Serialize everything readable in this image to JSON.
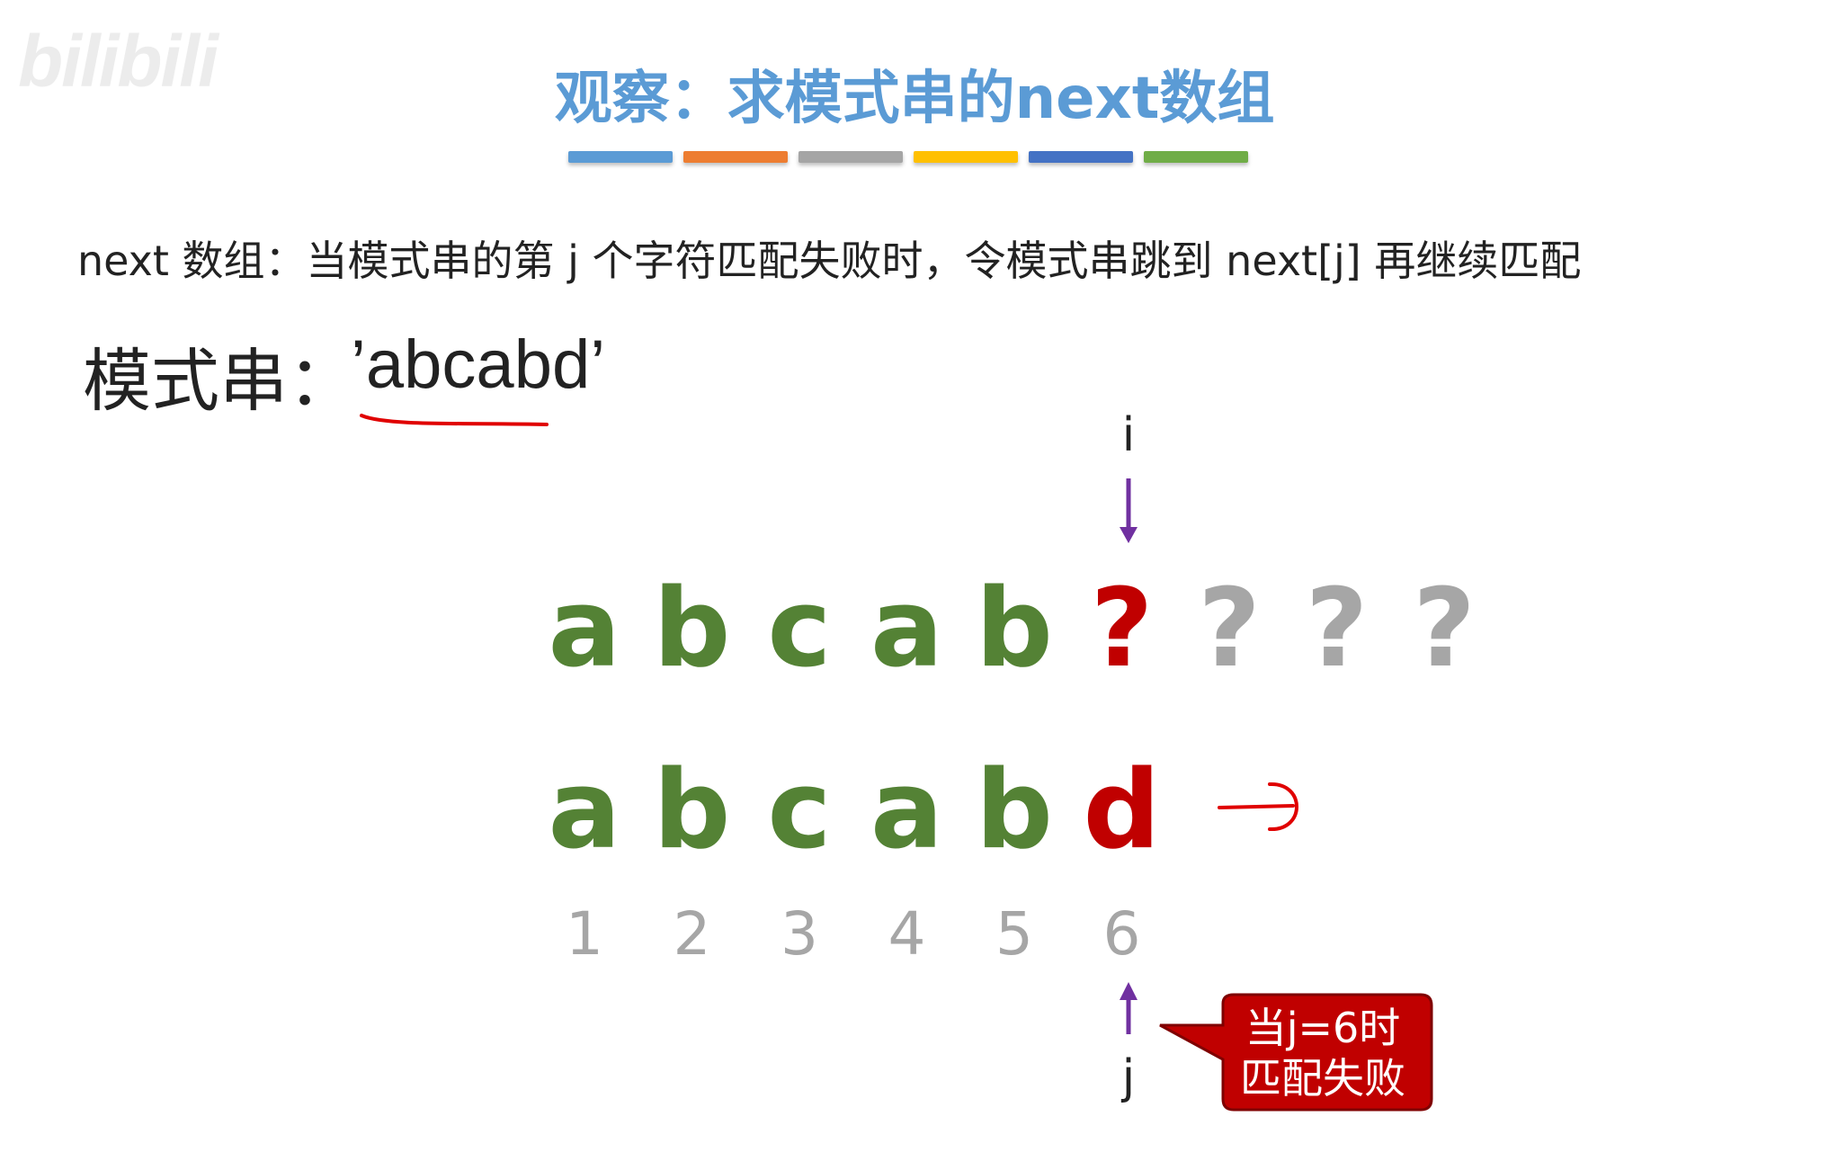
{
  "watermark": "bilibili",
  "title": "观察：求模式串的next数组",
  "title_bar_colors": [
    "#5b9bd5",
    "#ed7d31",
    "#a5a5a5",
    "#ffc000",
    "#4472c4",
    "#70ad47"
  ],
  "definition": "next 数组：当模式串的第 j 个字符匹配失败时，令模式串跳到 next[j] 再继续匹配",
  "pattern_label": "模式串：",
  "pattern_value": "’abcabd’",
  "main_string": [
    "a",
    "b",
    "c",
    "a",
    "b",
    "?",
    "?",
    "?",
    "?"
  ],
  "pattern_chars": [
    "a",
    "b",
    "c",
    "a",
    "b",
    "d"
  ],
  "indices": [
    "1",
    "2",
    "3",
    "4",
    "5",
    "6"
  ],
  "pointer_i_label": "i",
  "pointer_j_label": "j",
  "callout_line1": "当j=6时",
  "callout_line2": "匹配失败",
  "colors": {
    "match": "#548235",
    "mismatch": "#c00000",
    "unknown": "#a6a6a6",
    "pointer": "#7030a0",
    "annotation": "#e00000"
  }
}
